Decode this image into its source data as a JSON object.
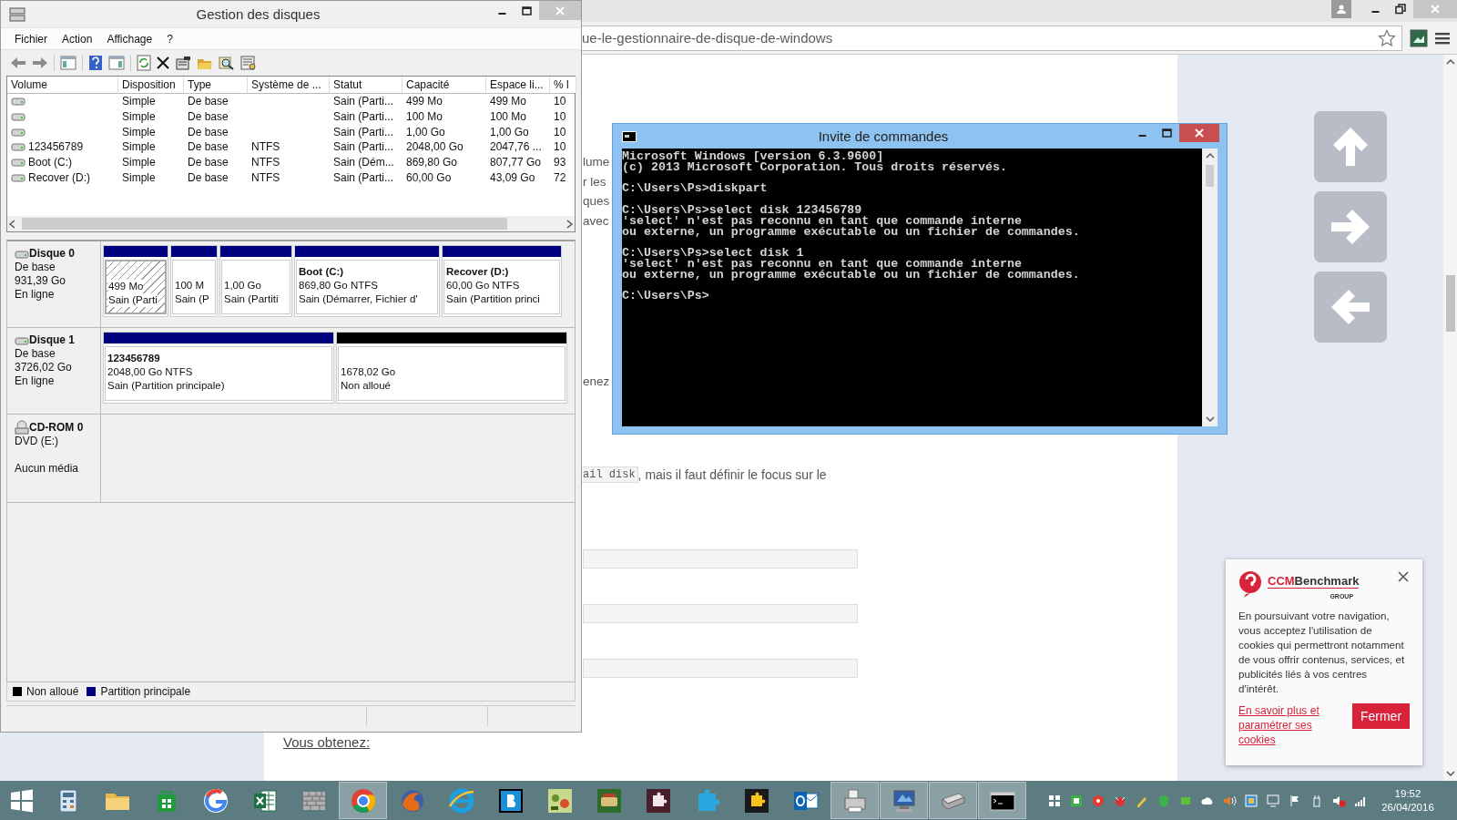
{
  "browser": {
    "url": "ue-le-gestionnaire-de-disque-de-windows",
    "fragments": [
      [
        "lume",
        "r les",
        "ques",
        "avec"
      ],
      [
        "enez"
      ]
    ],
    "code": "ail disk",
    "sentence": ", mais il faut définir le focus sur le",
    "subheading": "Vous obtenez:"
  },
  "cookie": {
    "brand_a": "CCM",
    "brand_b": "Benchmark",
    "tagline": "GROUP",
    "text": "En poursuivant votre navigation, vous acceptez l'utilisation de cookies qui permettront notamment de vous offrir contenus, services, et publicités liés à vos centres d'intérêt.",
    "link": "En savoir plus et paramétrer ses cookies",
    "button": "Fermer"
  },
  "disk_manager": {
    "title": "Gestion des disques",
    "menu": [
      "Fichier",
      "Action",
      "Affichage",
      "?"
    ],
    "columns": [
      "Volume",
      "Disposition",
      "Type",
      "Système de ...",
      "Statut",
      "Capacité",
      "Espace li...",
      "% l"
    ],
    "rows": [
      {
        "layout": "Simple",
        "type": "De base",
        "status": "Sain (Parti...",
        "capacity": "499 Mo",
        "free": "499 Mo",
        "pct": "10"
      },
      {
        "layout": "Simple",
        "type": "De base",
        "status": "Sain (Parti...",
        "capacity": "100 Mo",
        "free": "100 Mo",
        "pct": "10"
      },
      {
        "layout": "Simple",
        "type": "De base",
        "status": "Sain (Parti...",
        "capacity": "1,00 Go",
        "free": "1,00 Go",
        "pct": "10"
      },
      {
        "volume": "123456789",
        "layout": "Simple",
        "type": "De base",
        "fs": "NTFS",
        "status": "Sain (Parti...",
        "capacity": "2048,00 Go",
        "free": "2047,76 ...",
        "pct": "10"
      },
      {
        "volume": "Boot (C:)",
        "layout": "Simple",
        "type": "De base",
        "fs": "NTFS",
        "status": "Sain (Dém...",
        "capacity": "869,80 Go",
        "free": "807,77 Go",
        "pct": "93"
      },
      {
        "volume": "Recover (D:)",
        "layout": "Simple",
        "type": "De base",
        "fs": "NTFS",
        "status": "Sain (Parti...",
        "capacity": "60,00 Go",
        "free": "43,09 Go",
        "pct": "72"
      }
    ],
    "disks": [
      {
        "kind": "disk",
        "name": "Disque 0",
        "lines": [
          "De base",
          "931,39 Go",
          "En ligne"
        ],
        "partitions": [
          {
            "kind": "primary",
            "selected": true,
            "lines": [
              "499 Mo",
              "Sain (Parti"
            ]
          },
          {
            "kind": "primary",
            "selected": false,
            "lines": [
              "100 M",
              "Sain (P"
            ]
          },
          {
            "kind": "primary",
            "selected": false,
            "lines": [
              "1,00 Go",
              "Sain (Partiti"
            ]
          },
          {
            "kind": "primary",
            "selected": false,
            "title": "Boot (C:)",
            "lines": [
              "869,80 Go NTFS",
              "Sain (Démarrer, Fichier d'"
            ]
          },
          {
            "kind": "primary",
            "selected": false,
            "title": "Recover (D:)",
            "lines": [
              "60,00 Go NTFS",
              "Sain (Partition princi"
            ]
          }
        ]
      },
      {
        "kind": "disk",
        "name": "Disque 1",
        "lines": [
          "De base",
          "3726,02 Go",
          "En ligne"
        ],
        "partitions": [
          {
            "kind": "primary",
            "selected": false,
            "title": "123456789",
            "lines": [
              "2048,00 Go NTFS",
              "Sain (Partition principale)"
            ]
          },
          {
            "kind": "unallocated",
            "selected": false,
            "lines": [
              "1678,02 Go",
              "Non alloué"
            ]
          }
        ]
      },
      {
        "kind": "cdrom",
        "name": "CD-ROM 0",
        "lines": [
          "DVD (E:)"
        ],
        "status": "Aucun média"
      }
    ],
    "legend": [
      {
        "kind": "unallocated",
        "label": "Non alloué"
      },
      {
        "kind": "primary",
        "label": "Partition principale"
      }
    ]
  },
  "cmd": {
    "title": "Invite de commandes",
    "blocks": [
      [
        "Microsoft Windows [version 6.3.9600]",
        "(c) 2013 Microsoft Corporation. Tous droits réservés."
      ],
      [
        "C:\\Users\\Ps>diskpart"
      ],
      [
        "C:\\Users\\Ps>select disk 123456789",
        "'select' n'est pas reconnu en tant que commande interne",
        "ou externe, un programme exécutable ou un fichier de commandes."
      ],
      [
        "C:\\Users\\Ps>select disk 1",
        "'select' n'est pas reconnu en tant que commande interne",
        "ou externe, un programme exécutable ou un fichier de commandes."
      ],
      [
        "C:\\Users\\Ps>"
      ]
    ]
  },
  "taskbar": {
    "apps": [
      {
        "kind": "calculator",
        "running": false
      },
      {
        "kind": "folder",
        "running": false
      },
      {
        "kind": "bag",
        "running": false
      },
      {
        "kind": "ring",
        "running": false
      },
      {
        "kind": "sheet",
        "running": false
      },
      {
        "kind": "wall",
        "running": false
      },
      {
        "kind": "ball",
        "running": true
      },
      {
        "kind": "orange-globe",
        "running": false
      },
      {
        "kind": "blue-globe",
        "running": false
      },
      {
        "kind": "tile",
        "running": false
      },
      {
        "kind": "game",
        "running": false
      },
      {
        "kind": "green-game",
        "running": false
      },
      {
        "kind": "dark-puzzle",
        "running": false
      },
      {
        "kind": "blue-puzzle",
        "running": false
      },
      {
        "kind": "yellow-puzzle",
        "running": false
      },
      {
        "kind": "mail",
        "running": false
      },
      {
        "kind": "printer",
        "running": true
      },
      {
        "kind": "monitor",
        "running": true
      },
      {
        "kind": "scanner",
        "running": true
      },
      {
        "kind": "terminal",
        "running": true
      }
    ],
    "time": "19:52",
    "date": "26/04/2016"
  }
}
